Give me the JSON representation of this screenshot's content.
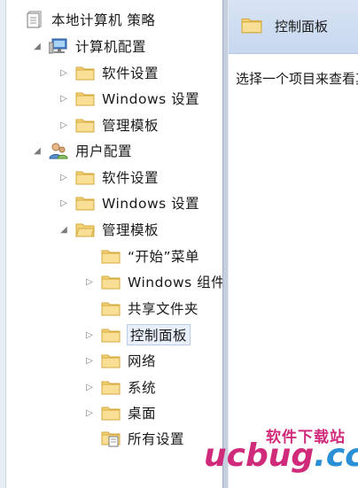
{
  "tree": {
    "root": {
      "label": "本地计算机 策略",
      "icon": "policy-document-icon"
    },
    "computer_config": {
      "label": "计算机配置",
      "icon": "computer-icon",
      "children": [
        {
          "label": "软件设置"
        },
        {
          "label": "Windows 设置"
        },
        {
          "label": "管理模板"
        }
      ]
    },
    "user_config": {
      "label": "用户配置",
      "icon": "users-icon",
      "children": [
        {
          "label": "软件设置"
        },
        {
          "label": "Windows 设置"
        },
        {
          "label": "管理模板",
          "expanded": true,
          "children": [
            {
              "label": "“开始”菜单"
            },
            {
              "label": "Windows 组件"
            },
            {
              "label": "共享文件夹"
            },
            {
              "label": "控制面板",
              "selected": true
            },
            {
              "label": "网络"
            },
            {
              "label": "系统"
            },
            {
              "label": "桌面"
            },
            {
              "label": "所有设置",
              "icon": "all-settings-icon"
            }
          ]
        }
      ]
    }
  },
  "details": {
    "title": "控制面板",
    "description": "选择一个项目来查看其描述。"
  },
  "watermark": {
    "cn": "软件下载站",
    "en_prefix": "ucbug",
    "en_suffix": ".cc"
  },
  "colors": {
    "folder": "#f3d27a",
    "folder_edge": "#d6a93b",
    "header_bg": "#cfdcef",
    "splitter": "#c5cfdd",
    "watermark_pink": "#d02a7b",
    "watermark_blue": "#2b8fd6"
  }
}
